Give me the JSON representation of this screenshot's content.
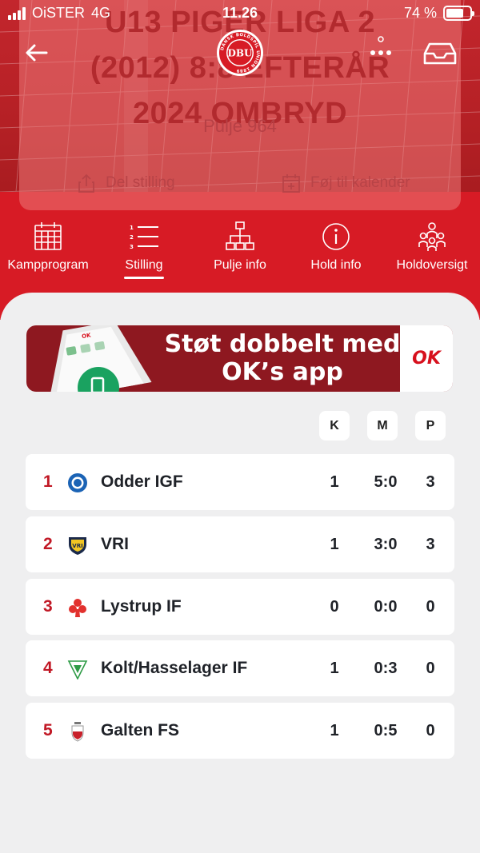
{
  "status_bar": {
    "carrier": "OiSTER",
    "network": "4G",
    "time": "11.26",
    "battery": "74 %",
    "battery_level": 0.74
  },
  "header": {
    "title_lines": [
      "U13 PIGER LIGA 2",
      "(2012) 8:8 EFTERÅR",
      "2024 OMBRYD"
    ],
    "pool": "Pulje 964",
    "share_label": "Del stilling",
    "calendar_label": "Føj til kalender",
    "logo_text": "DBU",
    "logo_ring_text": "DANSK BOLDSPIL UNION 1889"
  },
  "tabs": [
    {
      "label": "Kampprogram",
      "icon": "calendar-icon",
      "active": false
    },
    {
      "label": "Stilling",
      "icon": "numbered-list-icon",
      "active": true
    },
    {
      "label": "Pulje info",
      "icon": "hierarchy-icon",
      "active": false
    },
    {
      "label": "Hold info",
      "icon": "info-icon",
      "active": false
    },
    {
      "label": "Holdoversigt",
      "icon": "team-icon",
      "active": false
    }
  ],
  "banner": {
    "line1": "Støt dobbelt med",
    "line2": "OK’s app",
    "brand": "OK"
  },
  "table": {
    "columns": [
      "K",
      "M",
      "P"
    ],
    "rows": [
      {
        "pos": "1",
        "team": "Odder IGF",
        "k": "1",
        "m": "5:0",
        "p": "3",
        "crest_color": "#1b63b5"
      },
      {
        "pos": "2",
        "team": "VRI",
        "k": "1",
        "m": "3:0",
        "p": "3",
        "crest_color": "#f2c623"
      },
      {
        "pos": "3",
        "team": "Lystrup IF",
        "k": "0",
        "m": "0:0",
        "p": "0",
        "crest_color": "#e2312e"
      },
      {
        "pos": "4",
        "team": "Kolt/Hasselager IF",
        "k": "1",
        "m": "0:3",
        "p": "0",
        "crest_color": "#2e9b46"
      },
      {
        "pos": "5",
        "team": "Galten FS",
        "k": "1",
        "m": "0:5",
        "p": "0",
        "crest_color": "#c8202a"
      }
    ]
  },
  "colors": {
    "brand_red": "#d71b25",
    "position_red": "#c11825",
    "banner_red": "#8e1820"
  }
}
